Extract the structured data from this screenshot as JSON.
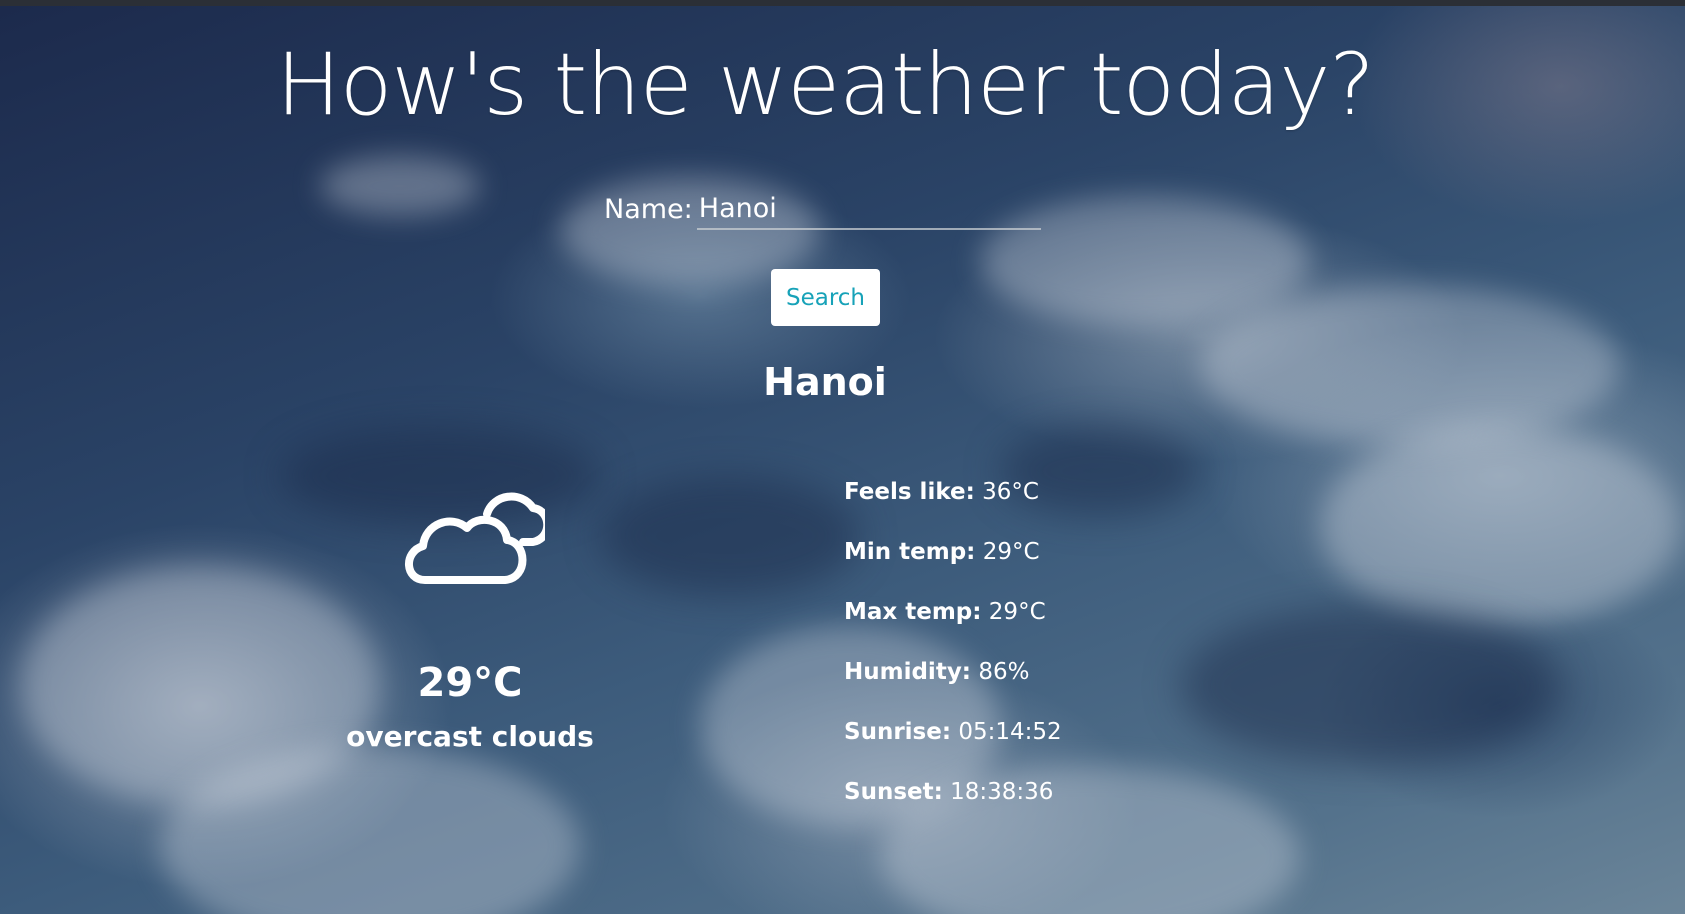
{
  "page": {
    "title": "How's the weather today?"
  },
  "search": {
    "label": "Name:",
    "value": "Hanoi",
    "button_label": "Search"
  },
  "weather": {
    "city": "Hanoi",
    "icon": "cloud-icon",
    "temperature": "29°C",
    "description": "overcast clouds",
    "details": [
      {
        "label": "Feels like:",
        "value": "36°C"
      },
      {
        "label": "Min temp:",
        "value": "29°C"
      },
      {
        "label": "Max temp:",
        "value": "29°C"
      },
      {
        "label": "Humidity:",
        "value": "86%"
      },
      {
        "label": "Sunrise:",
        "value": "05:14:52"
      },
      {
        "label": "Sunset:",
        "value": "18:38:36"
      }
    ]
  },
  "colors": {
    "button_text": "#17a2b8",
    "button_background": "#ffffff",
    "text": "#ffffff"
  }
}
